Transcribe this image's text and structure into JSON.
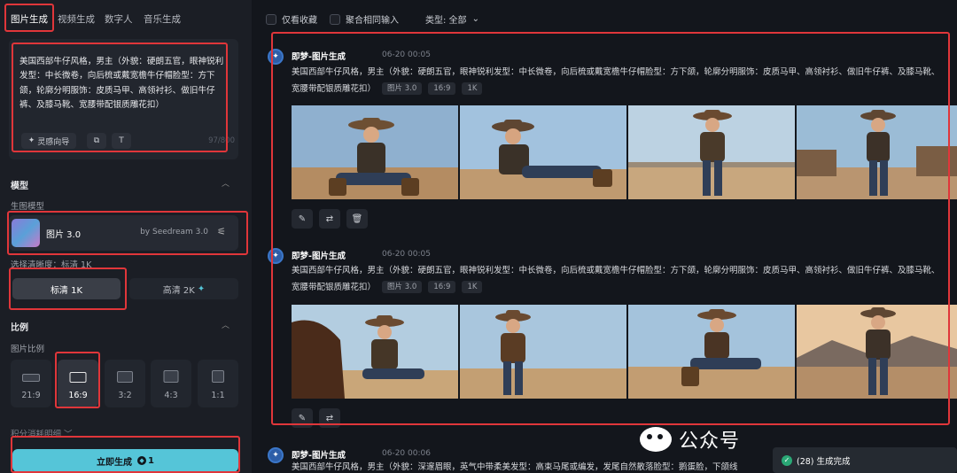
{
  "tabs": [
    "图片生成",
    "视频生成",
    "数字人",
    "音乐生成"
  ],
  "prompt": {
    "text": "美国西部牛仔风格，男主（外貌：硬朗五官，眼神锐利发型：中长微卷，向后梳或戴宽檐牛仔帽脸型：方下颌，轮廓分明服饰：皮质马甲、高领衬衫、做旧牛仔裤、及膝马靴、宽腰带配银质雕花扣）",
    "inspiration_label": "灵感向导",
    "char_count": "97/800"
  },
  "model": {
    "section_title": "模型",
    "sub_label": "生图模型",
    "name": "图片 3.0",
    "by": "by Seedream 3.0"
  },
  "resolution": {
    "label": "选择清晰度：标清 1K",
    "options": [
      "标清 1K",
      "高清 2K"
    ],
    "selected": "标清 1K"
  },
  "ratio": {
    "section_title": "比例",
    "sub_label": "图片比例",
    "options": [
      "21:9",
      "16:9",
      "3:2",
      "4:3",
      "1:1"
    ],
    "selected": "16:9"
  },
  "credits_label": "积分消耗明细",
  "generate": {
    "label": "立即生成",
    "cost": "1"
  },
  "filters": {
    "favorites": "仅看收藏",
    "merge": "聚合相同输入",
    "type": "类型: 全部"
  },
  "entries": [
    {
      "title": "即梦-图片生成",
      "time": "06-20  00:05",
      "text": "美国西部牛仔风格，男主（外貌：硬朗五官，眼神锐利发型：中长微卷，向后梳或戴宽檐牛仔帽脸型：方下颌，轮廓分明服饰：皮质马甲、高领衬衫、做旧牛仔裤、及膝马靴、宽腰带配银质雕花扣）",
      "tags": [
        "图片 3.0",
        "16:9",
        "1K"
      ]
    },
    {
      "title": "即梦-图片生成",
      "time": "06-20  00:05",
      "text": "美国西部牛仔风格，男主（外貌：硬朗五官，眼神锐利发型：中长微卷，向后梳或戴宽檐牛仔帽脸型：方下颌，轮廓分明服饰：皮质马甲、高领衬衫、做旧牛仔裤、及膝马靴、宽腰带配银质雕花扣）",
      "tags": [
        "图片 3.0",
        "16:9",
        "1K"
      ]
    },
    {
      "title": "即梦-图片生成",
      "time": "06-20  00:06",
      "text": "美国西部牛仔风格，男主（外貌：深邃眉眼，英气中带柔美发型：高束马尾或编发，发尾自然散落脸型：鹅蛋脸，下颌线",
      "tags": []
    }
  ],
  "watermark": "公众号",
  "badge": "(28) 生成完成",
  "colors": {
    "accent": "#55c5d8",
    "highlight": "#e0363a",
    "bg": "#13161c",
    "panel": "#1b1e25"
  }
}
